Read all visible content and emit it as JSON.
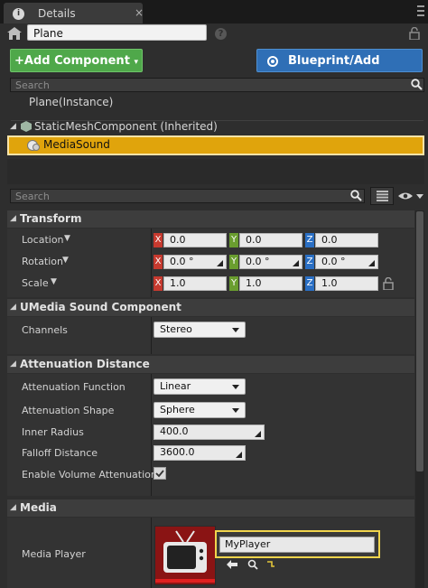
{
  "tab": {
    "title": "Details",
    "icon": "info-icon",
    "close": "×"
  },
  "actor": {
    "name": "Plane",
    "icon": "actor-icon",
    "help": "?"
  },
  "buttons": {
    "add_component": "+Add Component",
    "blueprint": "Blueprint/Add Script"
  },
  "component_search": {
    "placeholder": "Search"
  },
  "components": {
    "root": "Plane(Instance)",
    "inherited": "StaticMeshComponent (Inherited)",
    "selected": "MediaSound"
  },
  "details_search": {
    "placeholder": "Search"
  },
  "transform": {
    "title": "Transform",
    "rows": [
      {
        "label": "Location",
        "x": "0.0",
        "y": "0.0",
        "z": "0.0"
      },
      {
        "label": "Rotation",
        "x": "0.0 °",
        "y": "0.0 °",
        "z": "0.0 °"
      },
      {
        "label": "Scale",
        "x": "1.0",
        "y": "1.0",
        "z": "1.0"
      }
    ],
    "axis": {
      "x": "X",
      "y": "Y",
      "z": "Z"
    }
  },
  "umedia": {
    "title": "UMedia Sound Component",
    "channels_label": "Channels",
    "channels_value": "Stereo"
  },
  "attenuation": {
    "title": "Attenuation Distance",
    "function_label": "Attenuation Function",
    "function_value": "Linear",
    "shape_label": "Attenuation Shape",
    "shape_value": "Sphere",
    "inner_label": "Inner Radius",
    "inner_value": "400.0",
    "falloff_label": "Falloff Distance",
    "falloff_value": "3600.0",
    "enable_label": "Enable Volume Attenuation",
    "enable_checked": true
  },
  "media": {
    "title": "Media",
    "player_label": "Media Player",
    "player_value": "MyPlayer"
  },
  "colors": {
    "accent": "#e0a40c",
    "green": "#4fa84a",
    "blue": "#2f6fb6",
    "x": "#c63a2f",
    "y": "#6a9d2f",
    "z": "#2a6fc4"
  }
}
